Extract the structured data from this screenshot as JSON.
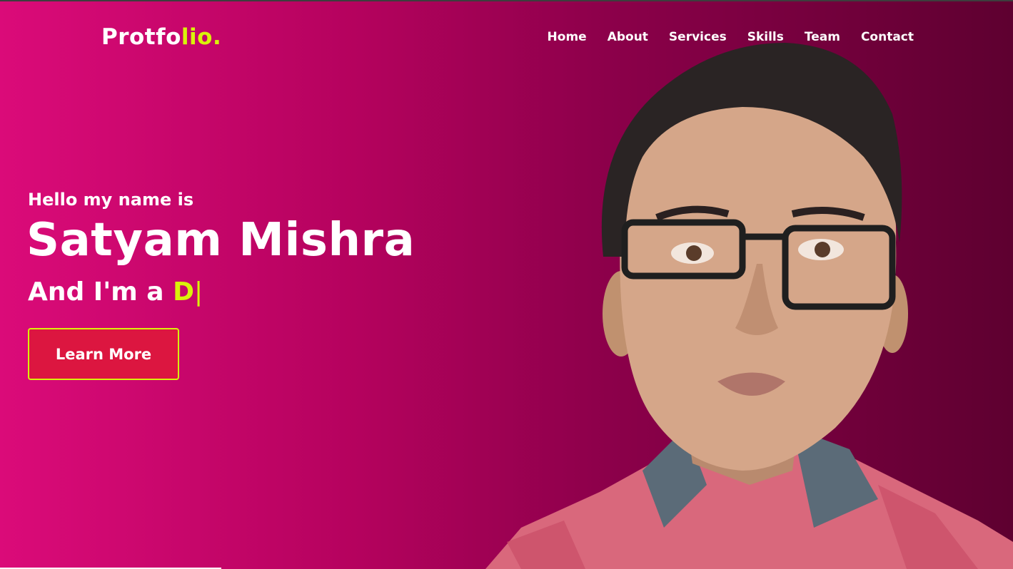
{
  "header": {
    "logo_main": "Protfo",
    "logo_accent": "lio."
  },
  "nav": {
    "items": [
      {
        "label": "Home"
      },
      {
        "label": "About"
      },
      {
        "label": "Services"
      },
      {
        "label": "Skills"
      },
      {
        "label": "Team"
      },
      {
        "label": "Contact"
      }
    ]
  },
  "hero": {
    "greeting": "Hello my name is",
    "name": "Satyam Mishra",
    "role_prefix": "And I'm a ",
    "role_typed": "D",
    "cursor": "|",
    "cta_label": "Learn More"
  },
  "colors": {
    "gradient_start": "#db0b79",
    "gradient_end": "#5e0030",
    "accent": "#d9f20a",
    "button": "#dc1640"
  }
}
